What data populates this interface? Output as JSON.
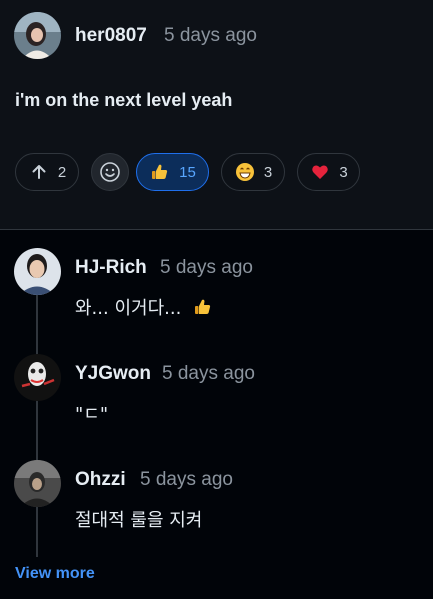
{
  "post": {
    "author": "her0807",
    "time": "5 days ago",
    "text": "i'm on the next level yeah",
    "reactions": {
      "upvote": {
        "icon": "arrow-up-icon",
        "count": "2"
      },
      "add_reaction": {
        "icon": "smiley-icon"
      },
      "thumbs_up": {
        "icon": "thumbs-up-icon",
        "count": "15"
      },
      "laugh": {
        "icon": "grinning-face-icon",
        "count": "3"
      },
      "heart": {
        "icon": "heart-icon",
        "count": "3"
      }
    }
  },
  "comments": [
    {
      "author": "HJ-Rich",
      "time": "5 days ago",
      "text": "와... 이거다...",
      "icon": "thumbs-up-icon"
    },
    {
      "author": "YJGwon",
      "time": "5 days ago",
      "text": "\"ㄷ\""
    },
    {
      "author": "Ohzzi",
      "time": "5 days ago",
      "text": "절대적 룰을 지켜"
    }
  ],
  "view_more_label": "View more",
  "colors": {
    "accent": "#4493f8",
    "active_bg": "#0c2d5a",
    "active_border": "#1f6feb",
    "muted": "#8b949e",
    "background": "#010409",
    "post_bg": "#0d1117"
  }
}
